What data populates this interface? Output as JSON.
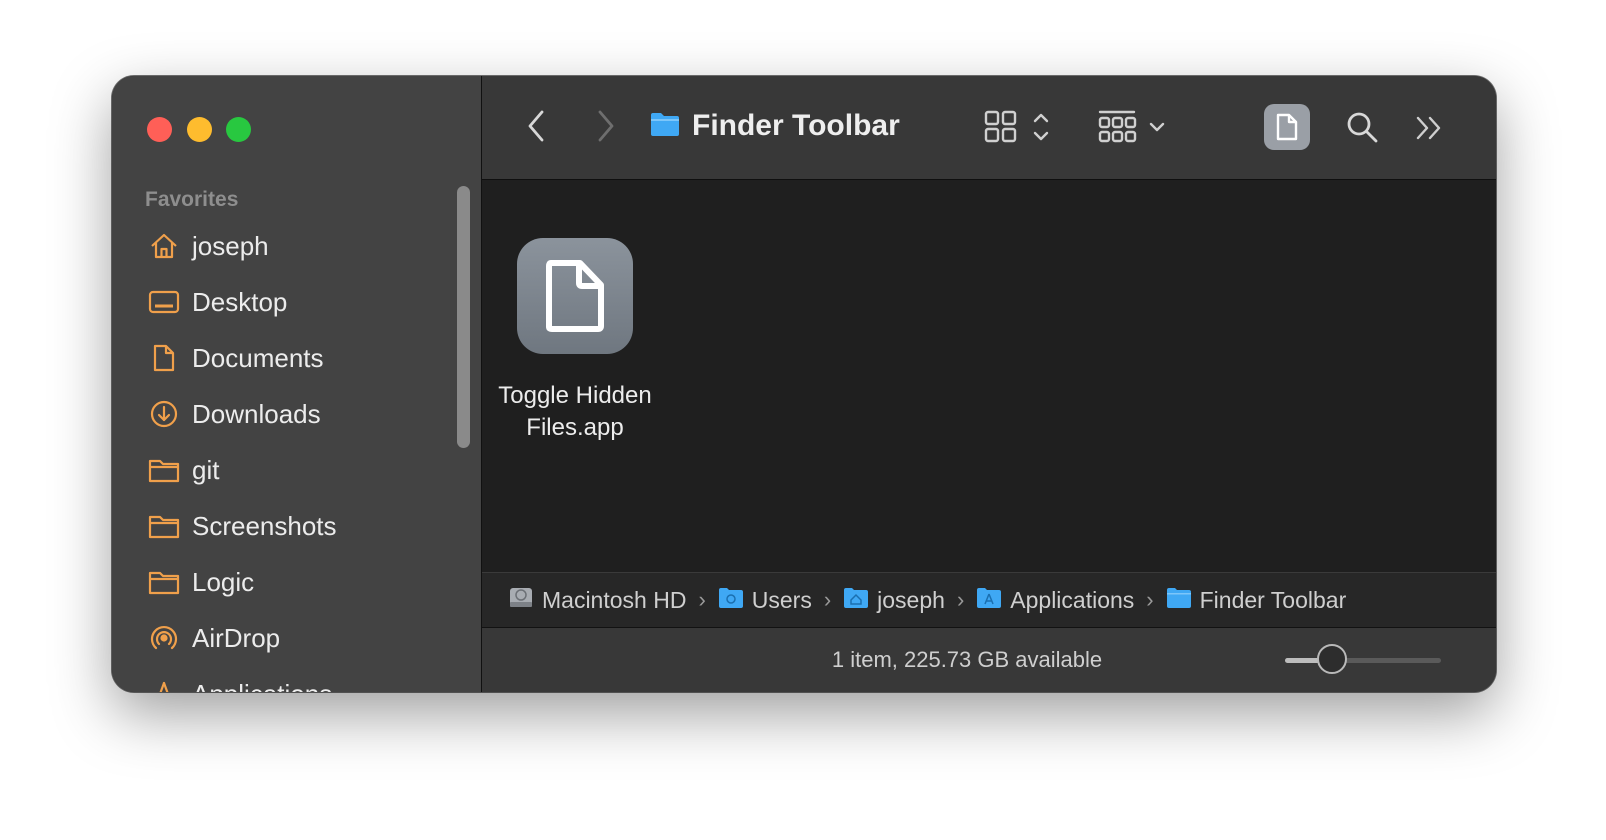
{
  "window": {
    "traffic_lights": {
      "close": "#ff5f57",
      "minimize": "#febc2e",
      "zoom": "#28c840"
    }
  },
  "sidebar": {
    "section_title": "Favorites",
    "accent_color": "#f0a04b",
    "items": [
      {
        "label": "joseph",
        "icon": "home-icon"
      },
      {
        "label": "Desktop",
        "icon": "desktop-icon"
      },
      {
        "label": "Documents",
        "icon": "document-icon"
      },
      {
        "label": "Downloads",
        "icon": "download-icon"
      },
      {
        "label": "git",
        "icon": "folder-icon"
      },
      {
        "label": "Screenshots",
        "icon": "folder-icon"
      },
      {
        "label": "Logic",
        "icon": "folder-icon"
      },
      {
        "label": "AirDrop",
        "icon": "airdrop-icon"
      },
      {
        "label": "Applications",
        "icon": "applications-icon"
      }
    ]
  },
  "toolbar": {
    "title": "Finder Toolbar",
    "folder_color": "#3fa8f4",
    "buttons": [
      "back-icon",
      "forward-icon",
      "icon-view-icon",
      "group-icon",
      "file-icon",
      "search-icon",
      "overflow-icon"
    ]
  },
  "content": {
    "files": [
      {
        "name": "Toggle Hidden Files.app",
        "icon": "document-app-icon"
      }
    ]
  },
  "pathbar": {
    "crumbs": [
      {
        "label": "Macintosh HD",
        "icon": "disk-icon"
      },
      {
        "label": "Users",
        "icon": "folder-icon"
      },
      {
        "label": "joseph",
        "icon": "home-folder-icon"
      },
      {
        "label": "Applications",
        "icon": "applications-folder-icon"
      },
      {
        "label": "Finder Toolbar",
        "icon": "folder-icon"
      }
    ],
    "separator": "›"
  },
  "statusbar": {
    "text": "1 item, 225.73 GB available",
    "icon_size_level": 0.3
  }
}
